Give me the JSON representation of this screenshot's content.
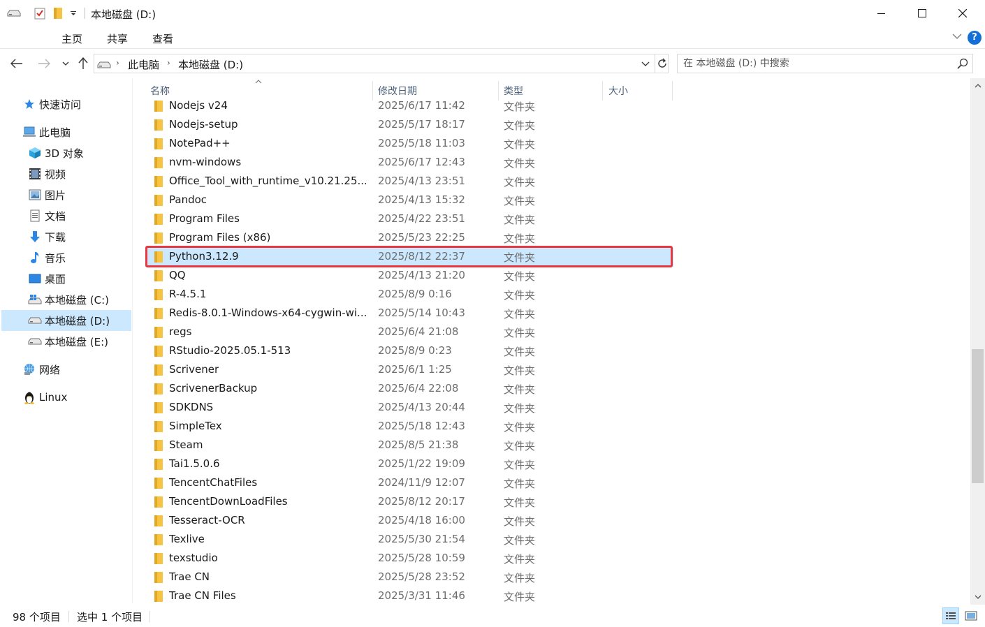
{
  "window": {
    "title": "本地磁盘 (D:)",
    "controls": {
      "minimize": "minimize",
      "maximize": "maximize",
      "close": "close"
    }
  },
  "ribbon": {
    "tabs": [
      "主页",
      "共享",
      "查看"
    ],
    "help_label": "?"
  },
  "address": {
    "crumbs": [
      "此电脑",
      "本地磁盘 (D:)"
    ],
    "search_placeholder": "在 本地磁盘 (D:) 中搜索"
  },
  "sidebar": {
    "items": [
      {
        "label": "快速访问",
        "icon": "star-icon"
      },
      {
        "label": "此电脑",
        "icon": "computer-icon"
      },
      {
        "label": "3D 对象",
        "icon": "cube-3d-icon"
      },
      {
        "label": "视频",
        "icon": "video-icon"
      },
      {
        "label": "图片",
        "icon": "pictures-icon"
      },
      {
        "label": "文档",
        "icon": "document-icon"
      },
      {
        "label": "下载",
        "icon": "download-icon"
      },
      {
        "label": "音乐",
        "icon": "music-icon"
      },
      {
        "label": "桌面",
        "icon": "desktop-icon"
      },
      {
        "label": "本地磁盘 (C:)",
        "icon": "windows-drive-icon"
      },
      {
        "label": "本地磁盘 (D:)",
        "icon": "drive-icon",
        "selected": true
      },
      {
        "label": "本地磁盘 (E:)",
        "icon": "drive-icon"
      },
      {
        "label": "网络",
        "icon": "network-icon"
      },
      {
        "label": "Linux",
        "icon": "linux-penguin-icon"
      }
    ]
  },
  "columns": {
    "name": "名称",
    "modified": "修改日期",
    "type": "类型",
    "size": "大小"
  },
  "files": [
    {
      "name": "Nodejs v24",
      "date": "2025/6/17 11:42",
      "type": "文件夹"
    },
    {
      "name": "Nodejs-setup",
      "date": "2025/5/17 18:17",
      "type": "文件夹"
    },
    {
      "name": "NotePad++",
      "date": "2025/5/18 11:03",
      "type": "文件夹"
    },
    {
      "name": "nvm-windows",
      "date": "2025/6/17 12:43",
      "type": "文件夹"
    },
    {
      "name": "Office_Tool_with_runtime_v10.21.25....",
      "date": "2025/4/13 23:51",
      "type": "文件夹"
    },
    {
      "name": "Pandoc",
      "date": "2025/4/13 15:32",
      "type": "文件夹"
    },
    {
      "name": "Program Files",
      "date": "2025/4/22 23:51",
      "type": "文件夹"
    },
    {
      "name": "Program Files (x86)",
      "date": "2025/5/23 22:25",
      "type": "文件夹"
    },
    {
      "name": "Python3.12.9",
      "date": "2025/8/12 22:37",
      "type": "文件夹",
      "selected": true
    },
    {
      "name": "QQ",
      "date": "2025/4/13 21:20",
      "type": "文件夹"
    },
    {
      "name": "R-4.5.1",
      "date": "2025/8/9 0:16",
      "type": "文件夹"
    },
    {
      "name": "Redis-8.0.1-Windows-x64-cygwin-wi...",
      "date": "2025/5/14 10:43",
      "type": "文件夹"
    },
    {
      "name": "regs",
      "date": "2025/6/4 21:08",
      "type": "文件夹"
    },
    {
      "name": "RStudio-2025.05.1-513",
      "date": "2025/8/9 0:23",
      "type": "文件夹"
    },
    {
      "name": "Scrivener",
      "date": "2025/6/1 1:25",
      "type": "文件夹"
    },
    {
      "name": "ScrivenerBackup",
      "date": "2025/6/4 22:08",
      "type": "文件夹"
    },
    {
      "name": "SDKDNS",
      "date": "2025/4/13 20:44",
      "type": "文件夹"
    },
    {
      "name": "SimpleTex",
      "date": "2025/5/18 12:43",
      "type": "文件夹"
    },
    {
      "name": "Steam",
      "date": "2025/8/5 21:38",
      "type": "文件夹"
    },
    {
      "name": "Tai1.5.0.6",
      "date": "2025/1/22 19:09",
      "type": "文件夹"
    },
    {
      "name": "TencentChatFiles",
      "date": "2024/11/9 12:07",
      "type": "文件夹"
    },
    {
      "name": "TencentDownLoadFiles",
      "date": "2025/8/12 20:17",
      "type": "文件夹"
    },
    {
      "name": "Tesseract-OCR",
      "date": "2025/4/18 16:00",
      "type": "文件夹"
    },
    {
      "name": "Texlive",
      "date": "2025/5/30 21:54",
      "type": "文件夹"
    },
    {
      "name": "texstudio",
      "date": "2025/5/28 10:59",
      "type": "文件夹"
    },
    {
      "name": "Trae CN",
      "date": "2025/5/28 23:52",
      "type": "文件夹"
    },
    {
      "name": "Trae CN Files",
      "date": "2025/3/31 11:46",
      "type": "文件夹"
    }
  ],
  "status": {
    "item_count": "98 个项目",
    "selected_count": "选中 1 个项目"
  },
  "colors": {
    "selection": "#cce8ff",
    "highlight_border": "#e8373e",
    "folder": "#f6c342",
    "accent": "#1470d6"
  }
}
